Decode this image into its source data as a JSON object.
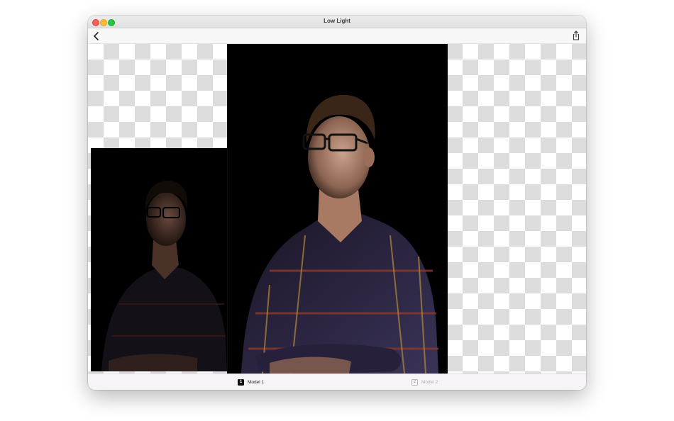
{
  "window": {
    "title": "Low Light"
  },
  "navbar": {
    "back_icon": "chevron-left-icon",
    "share_icon": "share-icon"
  },
  "canvas": {
    "background": "transparency-checkerboard",
    "images": [
      {
        "name": "main-photo",
        "description_icon": "photo"
      },
      {
        "name": "inset-photo",
        "description_icon": "photo"
      }
    ]
  },
  "tabs": [
    {
      "number": "1",
      "label": "Model 1",
      "active": true
    },
    {
      "number": "2",
      "label": "Model 2",
      "active": false
    }
  ],
  "colors": {
    "close": "#fe5f57",
    "minimize": "#febc2e",
    "zoom": "#28c840",
    "active_tab": "#111111",
    "inactive_tab": "#b0aeb0"
  }
}
